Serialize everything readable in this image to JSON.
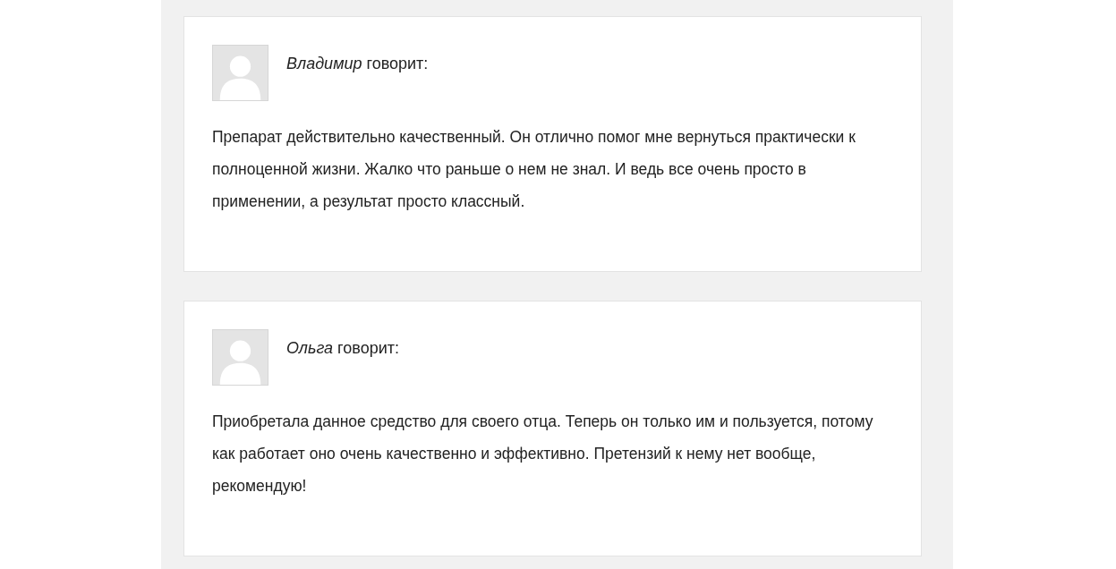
{
  "comments": [
    {
      "author": "Владимир",
      "verb": "говорит:",
      "text": "Препарат действительно качественный. Он отлично помог мне вернуться практически к полноценной жизни. Жалко что раньше о нем не знал. И ведь все очень просто в применении, а результат просто классный."
    },
    {
      "author": "Ольга",
      "verb": "говорит:",
      "text": "Приобретала данное средство для своего отца. Теперь он только им и пользуется, потому как работает оно очень качественно и эффективно. Претензий к нему нет вообще, рекомендую!"
    }
  ]
}
